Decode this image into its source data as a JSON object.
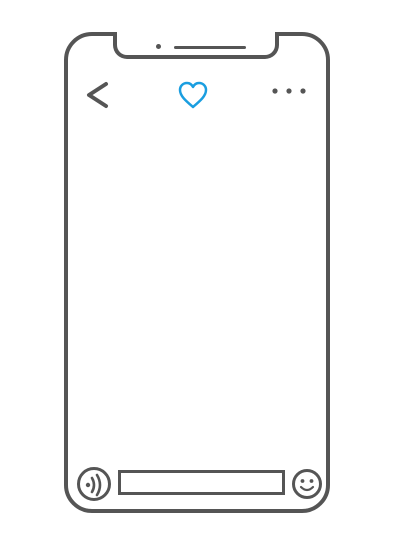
{
  "icons": {
    "back": "chevron-left-icon",
    "favorite": "heart-outline-icon",
    "more": "ellipsis-horizontal-icon",
    "voice": "voice-message-icon",
    "emoji": "smiley-face-icon"
  },
  "colors": {
    "frame": "#555555",
    "accent": "#1a9ee0",
    "background": "#ffffff"
  },
  "message_input": {
    "value": "",
    "placeholder": ""
  }
}
